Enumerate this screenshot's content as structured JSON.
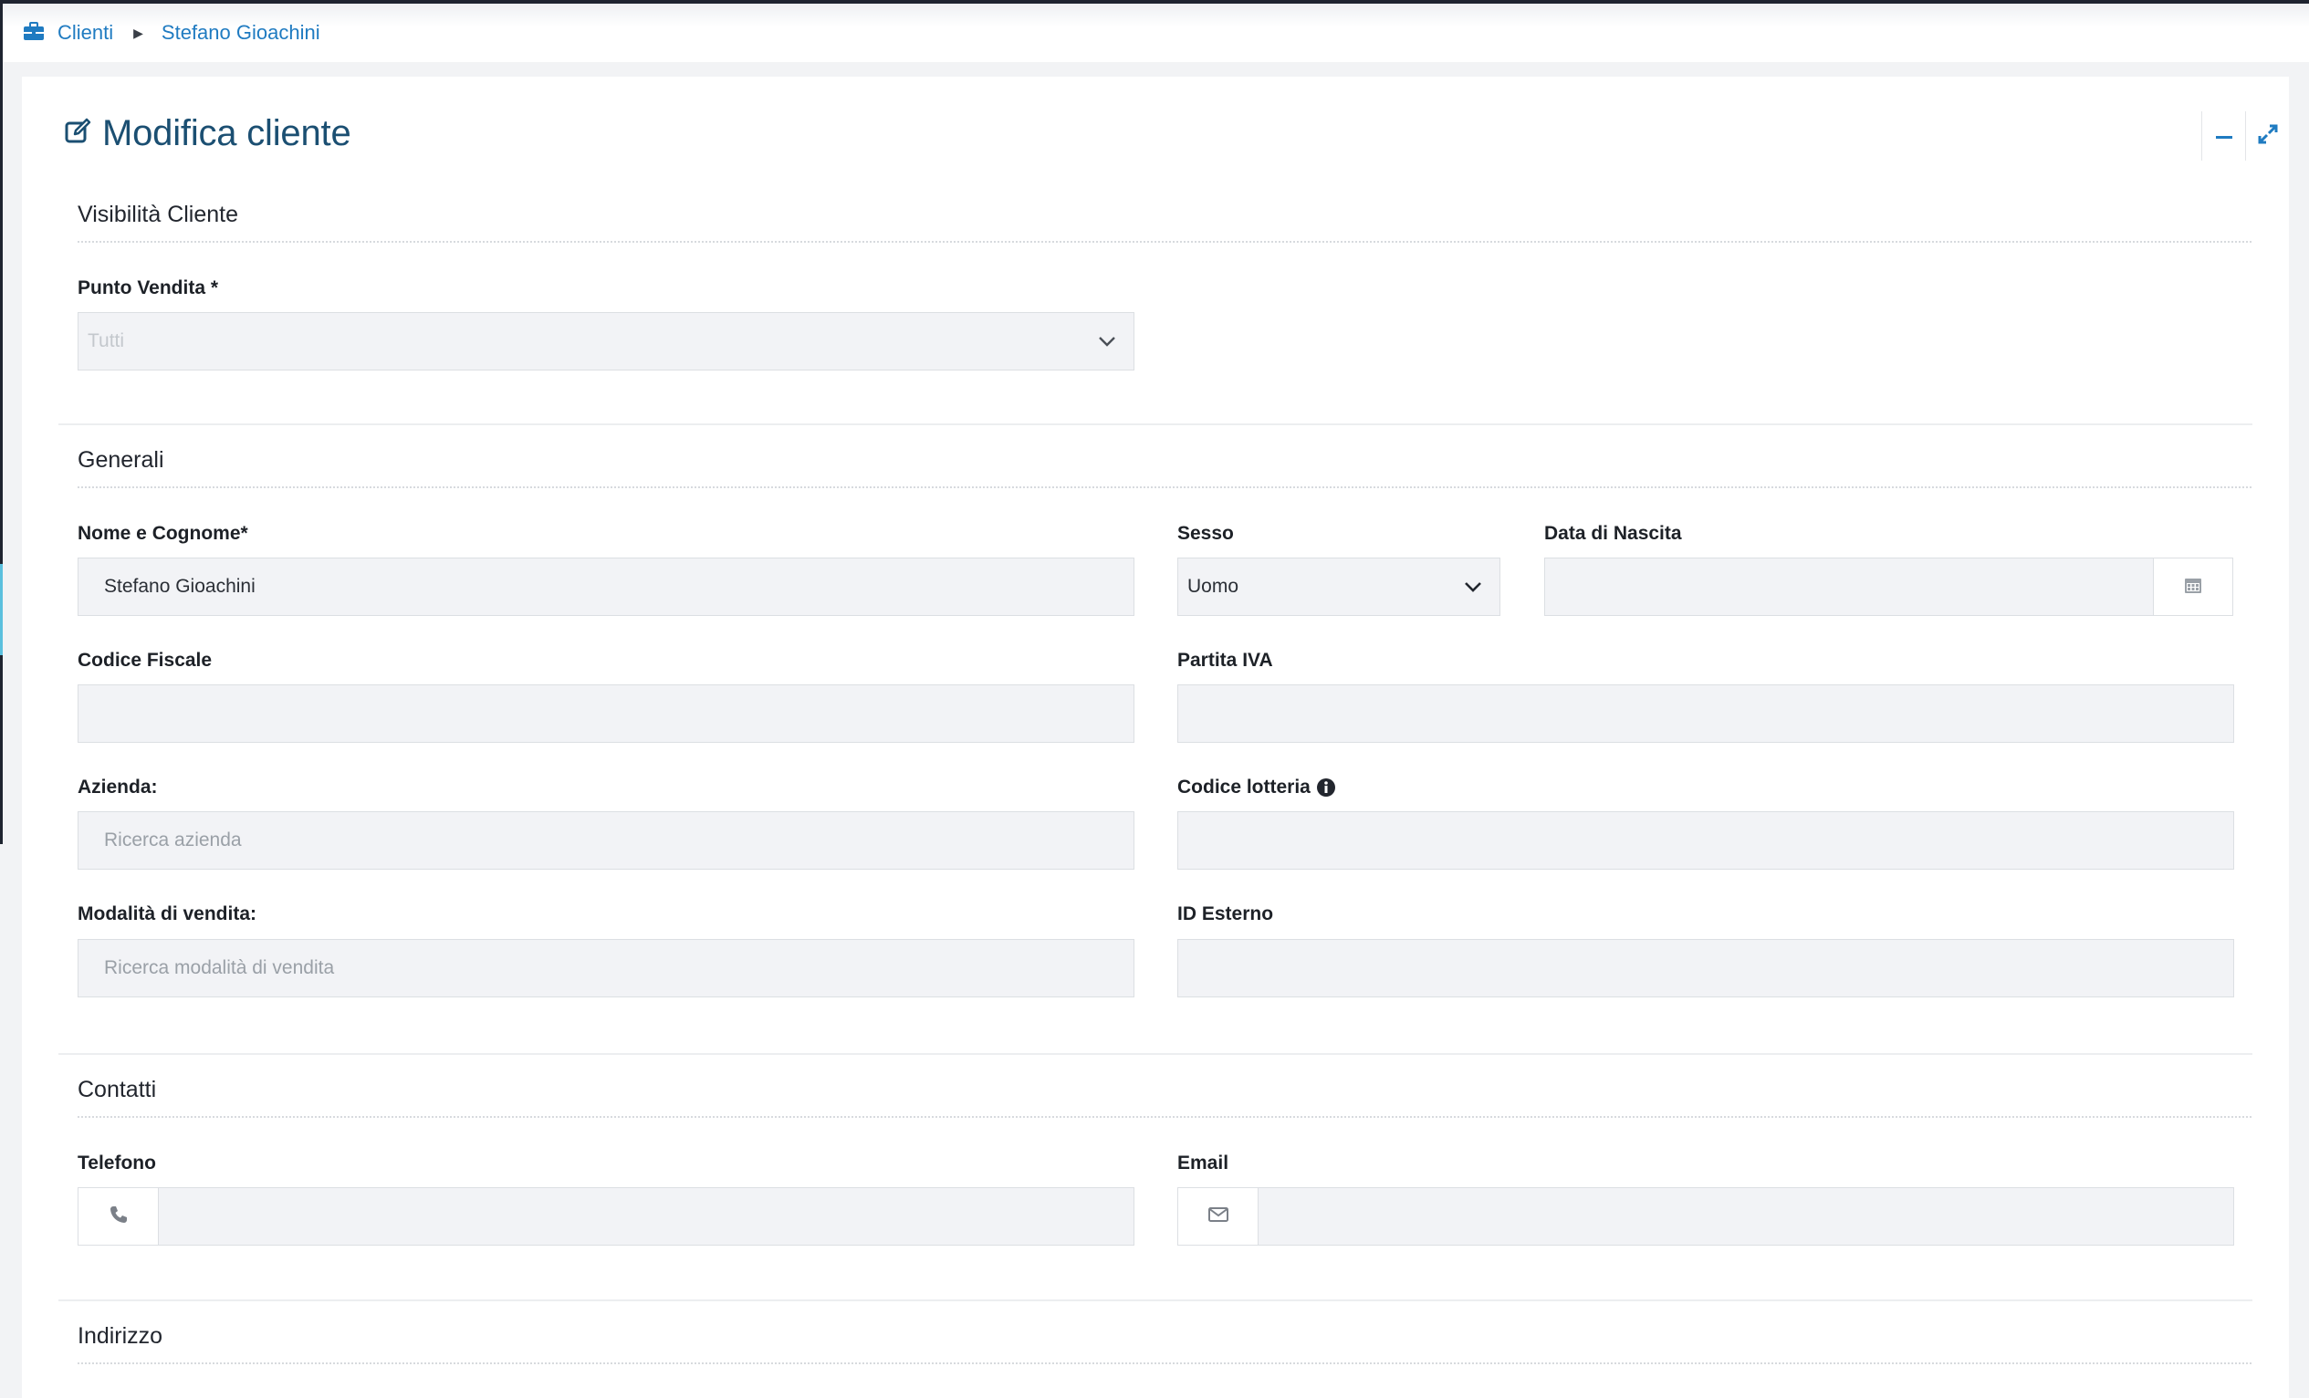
{
  "breadcrumb": {
    "root_label": "Clienti",
    "current_label": "Stefano Gioachini"
  },
  "card": {
    "title": "Modifica cliente"
  },
  "visibility": {
    "heading": "Visibilità Cliente",
    "punto_vendita": {
      "label": "Punto Vendita *",
      "value": "Tutti"
    }
  },
  "generali": {
    "heading": "Generali",
    "nome": {
      "label": "Nome e Cognome*",
      "value": "Stefano Gioachini"
    },
    "sesso": {
      "label": "Sesso",
      "value": "Uomo"
    },
    "data_nascita": {
      "label": "Data di Nascita",
      "value": ""
    },
    "codice_fiscale": {
      "label": "Codice Fiscale",
      "value": ""
    },
    "partita_iva": {
      "label": "Partita IVA",
      "value": ""
    },
    "azienda": {
      "label": "Azienda:",
      "placeholder": "Ricerca azienda"
    },
    "codice_lotteria": {
      "label": "Codice lotteria",
      "value": ""
    },
    "modalita_vendita": {
      "label": "Modalità di vendita:",
      "placeholder": "Ricerca modalità di vendita"
    },
    "id_esterno": {
      "label": "ID Esterno",
      "value": ""
    }
  },
  "contatti": {
    "heading": "Contatti",
    "telefono": {
      "label": "Telefono",
      "value": ""
    },
    "email": {
      "label": "Email",
      "value": ""
    }
  },
  "indirizzo": {
    "heading": "Indirizzo"
  },
  "colors": {
    "accent": "#1f7bc1",
    "title": "#1b4f72",
    "field_bg": "#f2f3f6"
  },
  "icons": [
    "briefcase-icon",
    "caret-right-icon",
    "edit-icon",
    "minimize-icon",
    "expand-icon",
    "chevron-down-icon",
    "calendar-icon",
    "info-icon",
    "phone-icon",
    "envelope-icon"
  ]
}
